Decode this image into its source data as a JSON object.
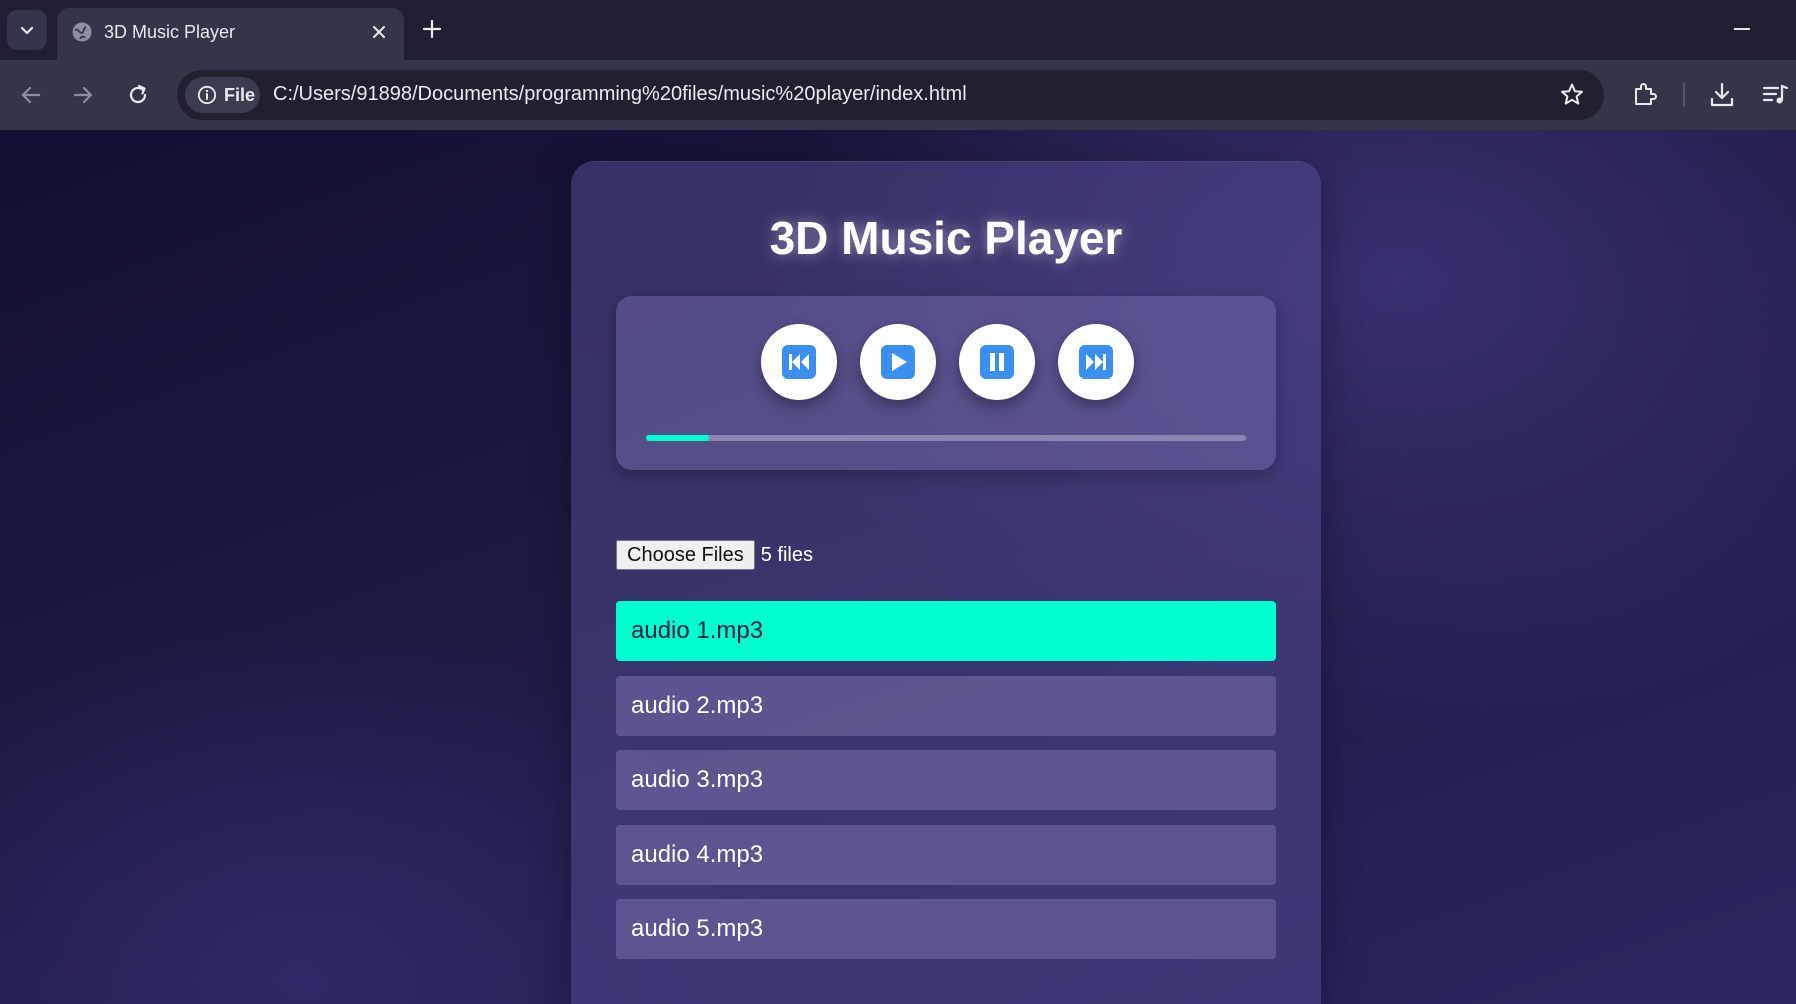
{
  "browser": {
    "tab_title": "3D Music Player",
    "site_chip_label": "File",
    "url": "C:/Users/91898/Documents/programming%20files/music%20player/index.html"
  },
  "player": {
    "title": "3D Music Player",
    "controls": [
      {
        "name": "previous",
        "icon": "skip-back-icon"
      },
      {
        "name": "play",
        "icon": "play-icon"
      },
      {
        "name": "pause",
        "icon": "pause-icon"
      },
      {
        "name": "next",
        "icon": "skip-forward-icon"
      }
    ],
    "progress": 0.105,
    "accent_color": "#00ffd0",
    "icon_color": "#3b8ff0"
  },
  "file_input": {
    "button_label": "Choose Files",
    "status": "5 files"
  },
  "playlist": {
    "active_index": 0,
    "tracks": [
      "audio 1.mp3",
      "audio 2.mp3",
      "audio 3.mp3",
      "audio 4.mp3",
      "audio 5.mp3"
    ]
  }
}
